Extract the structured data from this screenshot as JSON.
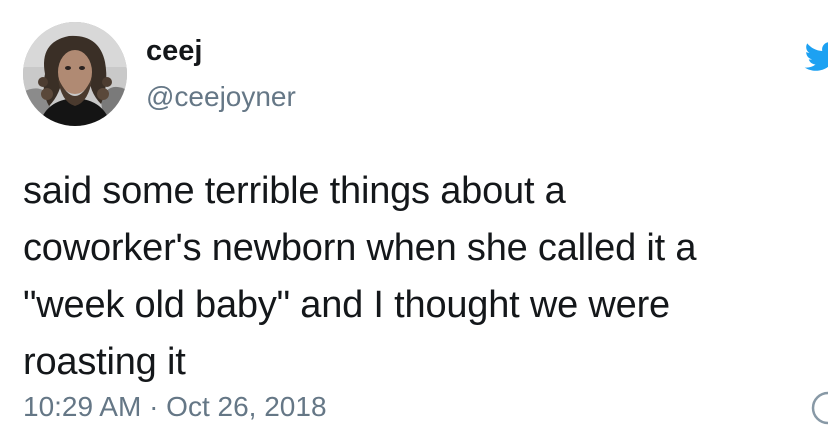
{
  "tweet": {
    "display_name": "ceej",
    "handle": "@ceejoyner",
    "text_lines": [
      "said some terrible things about a",
      "coworker's newborn when she called it a",
      "\"week old baby\" and I thought we were",
      "roasting it"
    ],
    "timestamp": "10:29 AM · Oct 26, 2018"
  },
  "icons": {
    "brand": "twitter-bird-icon",
    "info": "info-icon"
  },
  "colors": {
    "text": "#14171a",
    "secondary_text": "#657786",
    "twitter_blue": "#1da1f2",
    "background": "#ffffff"
  }
}
